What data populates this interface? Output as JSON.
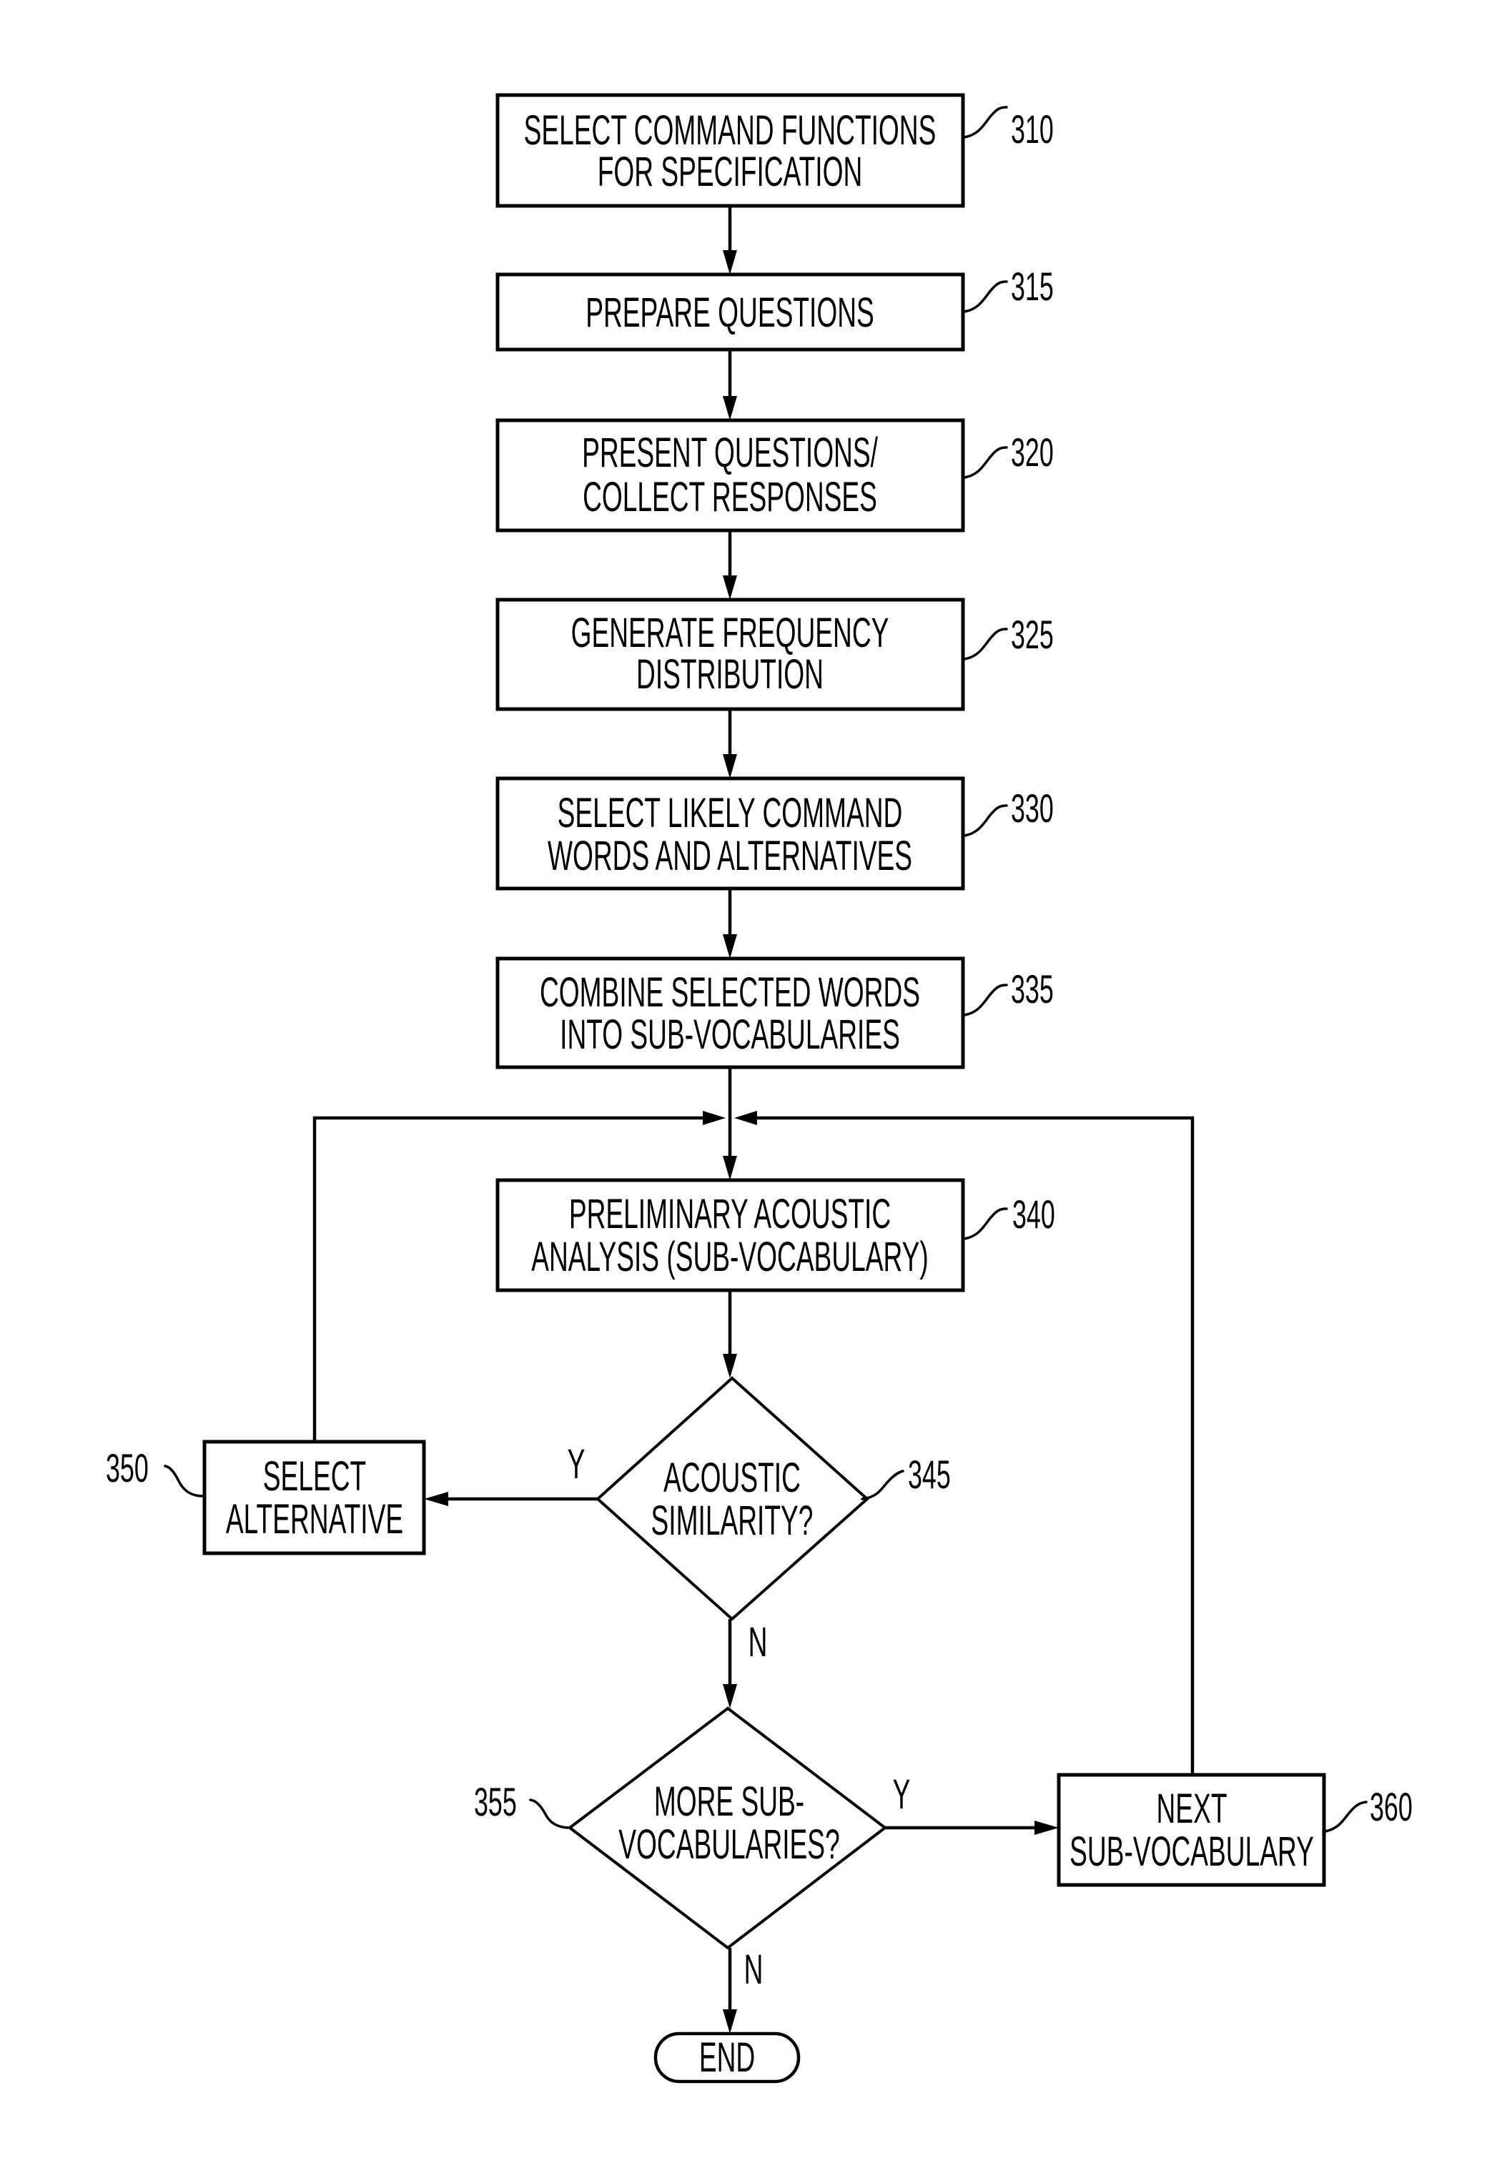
{
  "figure": {
    "steps": [
      {
        "ref": "310",
        "lines": [
          "SELECT COMMAND FUNCTIONS",
          "FOR SPECIFICATION"
        ]
      },
      {
        "ref": "315",
        "lines": [
          "PREPARE QUESTIONS"
        ]
      },
      {
        "ref": "320",
        "lines": [
          "PRESENT QUESTIONS/",
          "COLLECT RESPONSES"
        ]
      },
      {
        "ref": "325",
        "lines": [
          "GENERATE FREQUENCY",
          "DISTRIBUTION"
        ]
      },
      {
        "ref": "330",
        "lines": [
          "SELECT LIKELY COMMAND",
          "WORDS AND ALTERNATIVES"
        ]
      },
      {
        "ref": "335",
        "lines": [
          "COMBINE SELECTED WORDS",
          "INTO SUB-VOCABULARIES"
        ]
      },
      {
        "ref": "340",
        "lines": [
          "PRELIMINARY ACOUSTIC",
          "ANALYSIS (SUB-VOCABULARY)"
        ]
      }
    ],
    "decisions": [
      {
        "ref": "345",
        "lines": [
          "ACOUSTIC",
          "SIMILARITY?"
        ],
        "yes_label": "Y",
        "no_label": "N"
      },
      {
        "ref": "355",
        "lines": [
          "MORE SUB-",
          "VOCABULARIES?"
        ],
        "yes_label": "Y",
        "no_label": "N"
      }
    ],
    "side_steps": [
      {
        "ref": "350",
        "lines": [
          "SELECT",
          "ALTERNATIVE"
        ]
      },
      {
        "ref": "360",
        "lines": [
          "NEXT",
          "SUB-VOCABULARY"
        ]
      }
    ],
    "terminal": {
      "label": "END"
    }
  }
}
